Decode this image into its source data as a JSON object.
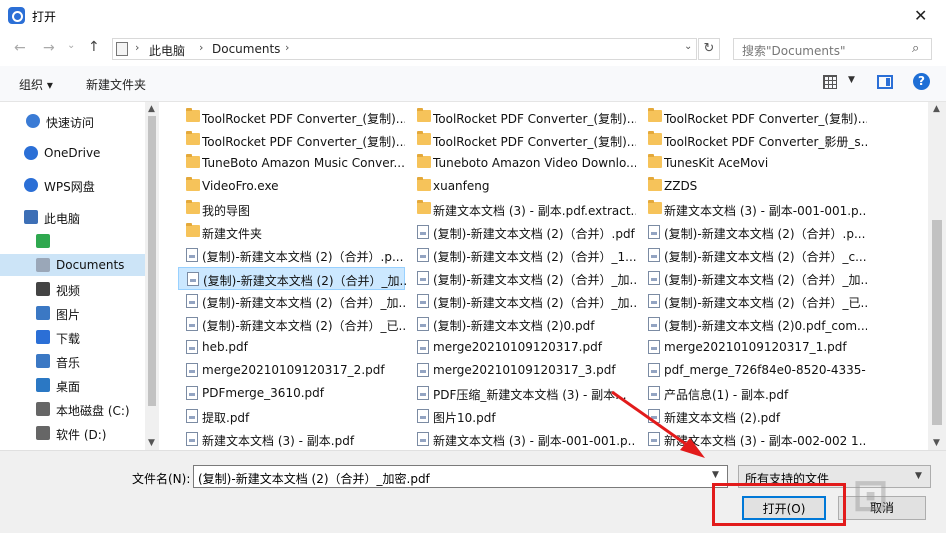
{
  "window": {
    "title": "打开"
  },
  "address": {
    "crumbs": [
      "此电脑",
      "Documents"
    ]
  },
  "search": {
    "placeholder": "搜索\"Documents\""
  },
  "toolbar": {
    "organize": "组织 ▾",
    "new_folder": "新建文件夹"
  },
  "sidebar": {
    "items": [
      {
        "label": "快速访问",
        "icon": "star-icon"
      },
      {
        "label": "OneDrive",
        "icon": "cloud-icon"
      },
      {
        "label": "WPS网盘",
        "icon": "cloud-icon"
      },
      {
        "label": "此电脑",
        "icon": "computer-icon"
      },
      {
        "label": "",
        "icon": "green-app-icon"
      },
      {
        "label": "Documents",
        "icon": "documents-icon",
        "selected": true
      },
      {
        "label": "视频",
        "icon": "video-icon"
      },
      {
        "label": "图片",
        "icon": "pictures-icon"
      },
      {
        "label": "下载",
        "icon": "download-icon"
      },
      {
        "label": "音乐",
        "icon": "music-icon"
      },
      {
        "label": "桌面",
        "icon": "desktop-icon"
      },
      {
        "label": "本地磁盘 (C:)",
        "icon": "drive-icon"
      },
      {
        "label": "软件 (D:)",
        "icon": "drive-icon"
      }
    ]
  },
  "files": {
    "col1": [
      {
        "name": "ToolRocket PDF Converter_(复制)...",
        "type": "folder"
      },
      {
        "name": "ToolRocket PDF Converter_(复制)...",
        "type": "folder"
      },
      {
        "name": "TuneBoto Amazon Music Conver...",
        "type": "folder"
      },
      {
        "name": "VideoFro.exe",
        "type": "folder"
      },
      {
        "name": "我的导图",
        "type": "folder"
      },
      {
        "name": "新建文件夹",
        "type": "folder"
      },
      {
        "name": "(复制)-新建文本文档 (2)（合并）.p...",
        "type": "pdf"
      },
      {
        "name": "(复制)-新建文本文档 (2)（合并）_加...",
        "type": "pdf",
        "selected": true
      },
      {
        "name": "(复制)-新建文本文档 (2)（合并）_加...",
        "type": "pdf"
      },
      {
        "name": "(复制)-新建文本文档 (2)（合并）_已...",
        "type": "pdf"
      },
      {
        "name": "heb.pdf",
        "type": "pdf"
      },
      {
        "name": "merge20210109120317_2.pdf",
        "type": "pdf"
      },
      {
        "name": "PDFmerge_3610.pdf",
        "type": "pdf"
      },
      {
        "name": "提取.pdf",
        "type": "pdf"
      },
      {
        "name": "新建文本文档 (3) - 副本.pdf",
        "type": "pdf"
      }
    ],
    "col2": [
      {
        "name": "ToolRocket PDF Converter_(复制)...",
        "type": "folder"
      },
      {
        "name": "ToolRocket PDF Converter_(复制)...",
        "type": "folder"
      },
      {
        "name": "Tuneboto Amazon Video Downlo...",
        "type": "folder"
      },
      {
        "name": "xuanfeng",
        "type": "folder"
      },
      {
        "name": "新建文本文档 (3) - 副本.pdf.extract...",
        "type": "folder"
      },
      {
        "name": "(复制)-新建文本文档 (2)（合并）.pdf",
        "type": "pdf"
      },
      {
        "name": "(复制)-新建文本文档 (2)（合并）_1...",
        "type": "pdf"
      },
      {
        "name": "(复制)-新建文本文档 (2)（合并）_加...",
        "type": "pdf"
      },
      {
        "name": "(复制)-新建文本文档 (2)（合并）_加...",
        "type": "pdf"
      },
      {
        "name": "(复制)-新建文本文档 (2)0.pdf",
        "type": "pdf"
      },
      {
        "name": "merge20210109120317.pdf",
        "type": "pdf"
      },
      {
        "name": "merge20210109120317_3.pdf",
        "type": "pdf"
      },
      {
        "name": "PDF压缩_新建文本文档 (3) - 副本...",
        "type": "pdf"
      },
      {
        "name": "图片10.pdf",
        "type": "pdf"
      },
      {
        "name": "新建文本文档 (3) - 副本-001-001.p...",
        "type": "pdf"
      }
    ],
    "col3": [
      {
        "name": "ToolRocket PDF Converter_(复制)...",
        "type": "folder"
      },
      {
        "name": "ToolRocket PDF Converter_影册_s...",
        "type": "folder"
      },
      {
        "name": "TunesKit AceMovi",
        "type": "folder"
      },
      {
        "name": "ZZDS",
        "type": "folder"
      },
      {
        "name": "新建文本文档 (3) - 副本-001-001.p...",
        "type": "folder"
      },
      {
        "name": "(复制)-新建文本文档 (2)（合并）.p...",
        "type": "pdf"
      },
      {
        "name": "(复制)-新建文本文档 (2)（合并）_c...",
        "type": "pdf"
      },
      {
        "name": "(复制)-新建文本文档 (2)（合并）_加...",
        "type": "pdf"
      },
      {
        "name": "(复制)-新建文本文档 (2)（合并）_已...",
        "type": "pdf"
      },
      {
        "name": "(复制)-新建文本文档 (2)0.pdf_com...",
        "type": "pdf"
      },
      {
        "name": "merge20210109120317_1.pdf",
        "type": "pdf"
      },
      {
        "name": "pdf_merge_726f84e0-8520-4335-...",
        "type": "pdf"
      },
      {
        "name": "产品信息(1) - 副本.pdf",
        "type": "pdf"
      },
      {
        "name": "新建文本文档 (2).pdf",
        "type": "pdf"
      },
      {
        "name": "新建文本文档 (3) - 副本-002-002 1...",
        "type": "pdf"
      }
    ]
  },
  "bottom": {
    "filename_label": "文件名(N):",
    "filename_value": "(复制)-新建文本文档 (2)（合并）_加密.pdf",
    "filter_value": "所有支持的文件",
    "open_label": "打开(O)",
    "cancel_label": "取消"
  },
  "colors": {
    "accent": "#0078d7",
    "highlight": "#e21b1b",
    "selection": "#cce8ff"
  }
}
